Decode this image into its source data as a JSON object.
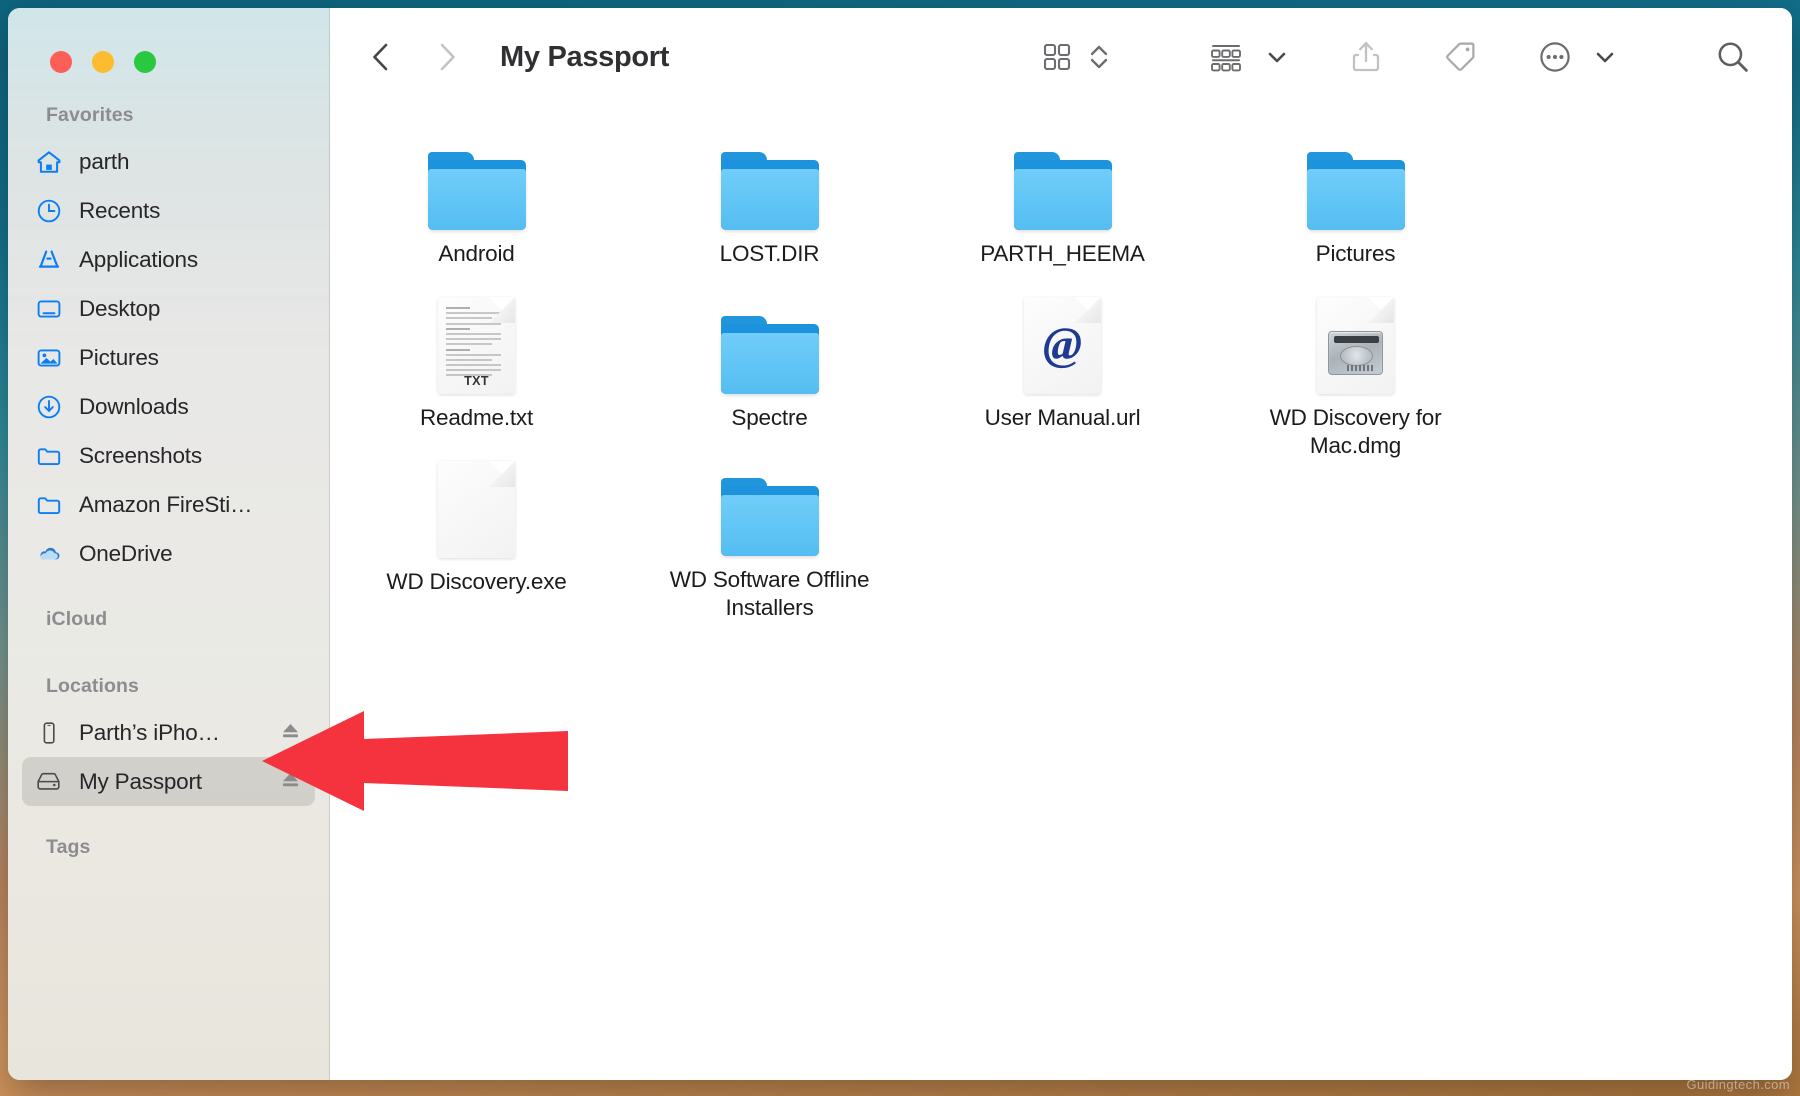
{
  "window": {
    "title": "My Passport",
    "traffic_lights": [
      {
        "name": "close",
        "color": "#fc5f57"
      },
      {
        "name": "minimize",
        "color": "#fdbc2e"
      },
      {
        "name": "zoom",
        "color": "#28c840"
      }
    ]
  },
  "toolbar": {
    "back_label": "Back",
    "forward_label": "Forward",
    "title": "My Passport",
    "buttons": [
      {
        "name": "icon-view",
        "label": "Icon View"
      },
      {
        "name": "view-stepper",
        "label": "Change View Options"
      },
      {
        "name": "group-by",
        "label": "Group Items"
      },
      {
        "name": "group-by-chevron",
        "label": "Group Options"
      },
      {
        "name": "share",
        "label": "Share"
      },
      {
        "name": "tag",
        "label": "Tags"
      },
      {
        "name": "more-actions",
        "label": "More"
      },
      {
        "name": "more-chevron",
        "label": "More Options"
      },
      {
        "name": "search",
        "label": "Search"
      }
    ]
  },
  "sidebar": {
    "sections": [
      {
        "heading": "Favorites",
        "items": [
          {
            "label": "parth",
            "icon": "home-icon",
            "eject": false,
            "selected": false
          },
          {
            "label": "Recents",
            "icon": "clock-icon",
            "eject": false,
            "selected": false
          },
          {
            "label": "Applications",
            "icon": "applications-icon",
            "eject": false,
            "selected": false
          },
          {
            "label": "Desktop",
            "icon": "desktop-icon",
            "eject": false,
            "selected": false
          },
          {
            "label": "Pictures",
            "icon": "pictures-icon",
            "eject": false,
            "selected": false
          },
          {
            "label": "Downloads",
            "icon": "downloads-icon",
            "eject": false,
            "selected": false
          },
          {
            "label": "Screenshots",
            "icon": "folder-icon",
            "eject": false,
            "selected": false
          },
          {
            "label": "Amazon FireSti…",
            "icon": "folder-icon",
            "eject": false,
            "selected": false
          },
          {
            "label": "OneDrive",
            "icon": "cloud-icon",
            "eject": false,
            "selected": false
          }
        ]
      },
      {
        "heading": "iCloud",
        "items": []
      },
      {
        "heading": "Locations",
        "items": [
          {
            "label": "Parth’s iPho…",
            "icon": "iphone-icon",
            "eject": true,
            "selected": false
          },
          {
            "label": "My Passport",
            "icon": "external-drive-icon",
            "eject": true,
            "selected": true
          }
        ]
      },
      {
        "heading": "Tags",
        "items": []
      }
    ]
  },
  "files": [
    {
      "name": "Android",
      "kind": "folder"
    },
    {
      "name": "LOST.DIR",
      "kind": "folder"
    },
    {
      "name": "PARTH_HEEMA",
      "kind": "folder"
    },
    {
      "name": "Pictures",
      "kind": "folder"
    },
    {
      "name": "Readme.txt",
      "kind": "text-document",
      "badge": "TXT"
    },
    {
      "name": "Spectre",
      "kind": "folder"
    },
    {
      "name": "User Manual.url",
      "kind": "url-document",
      "badge": "@"
    },
    {
      "name": "WD Discovery for Mac.dmg",
      "kind": "disk-image"
    },
    {
      "name": "WD Discovery.exe",
      "kind": "blank-document"
    },
    {
      "name": "WD Software Offline Installers",
      "kind": "folder"
    }
  ],
  "annotation": {
    "arrow_color": "#F5333F",
    "points_to": "My Passport"
  },
  "watermark": "Guidingtech.com"
}
